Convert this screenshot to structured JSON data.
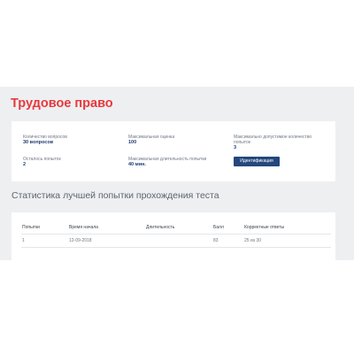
{
  "page": {
    "title": "Трудовое право"
  },
  "info": {
    "questions_count": {
      "label": "Количество вопросов",
      "value": "30 вопросов"
    },
    "max_score": {
      "label": "Максимальная оценка",
      "value": "100"
    },
    "max_attempts": {
      "label": "Максимально допустимое количество попыток",
      "value": "3"
    },
    "attempts_left": {
      "label": "Осталось попыток",
      "value": "2"
    },
    "max_duration": {
      "label": "Максимальная длительность попытки",
      "value": "40 мин."
    },
    "identify_button": "Идентификация"
  },
  "stats": {
    "title": "Статистика лучшей попытки прохождения теста",
    "columns": [
      "Попытки",
      "Время начала",
      "Длительность",
      "Балл",
      "Корректные ответы"
    ],
    "rows": [
      [
        "1",
        "12-09-2018",
        "",
        "83",
        "25 из 30"
      ]
    ]
  },
  "colors": {
    "title": "#e8383d",
    "accent": "#24477d",
    "value_text": "#1f3d73",
    "background": "#eeeff1"
  }
}
